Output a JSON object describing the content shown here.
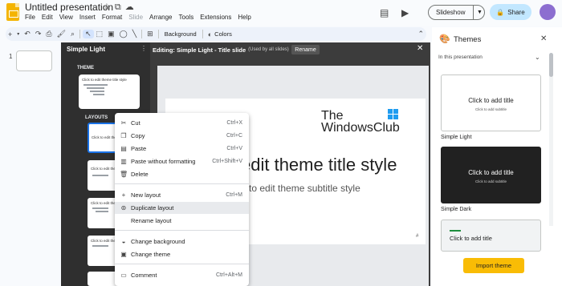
{
  "header": {
    "doc_title": "Untitled presentation",
    "title_icons": [
      "star-icon",
      "move-folder-icon",
      "cloud-status-icon"
    ],
    "menu": [
      "File",
      "Edit",
      "View",
      "Insert",
      "Format",
      "Slide",
      "Arrange",
      "Tools",
      "Extensions",
      "Help"
    ],
    "slideshow_label": "Slideshow",
    "share_label": "Share",
    "brand_color": "#f4b400",
    "share_color": "#c2e7ff"
  },
  "toolbar": {
    "background_label": "Background",
    "colors_label": "Colors"
  },
  "filmstrip": {
    "slide_number": "1"
  },
  "theme_builder": {
    "title": "Simple Light",
    "theme_section": "THEME",
    "layouts_section": "LAYOUTS",
    "editing_title": "Editing: Simple Light - Title slide",
    "editing_sub": "(Used by all slides)",
    "rename_label": "Rename",
    "theme_thumb_text": "Click to edit theme title style",
    "layout_thumb_text": "Click to edit theme title",
    "layout_thumb_text2": "Click to edit theme title style"
  },
  "slide": {
    "logo_line1": "The",
    "logo_line2": "WindowsClub",
    "title": "edit theme title style",
    "subtitle": "to edit theme subtitle style",
    "page_mark": "#"
  },
  "context_menu": {
    "items": [
      {
        "label": "Cut",
        "shortcut": "Ctrl+X",
        "icon": "cut-icon"
      },
      {
        "label": "Copy",
        "shortcut": "Ctrl+C",
        "icon": "copy-icon"
      },
      {
        "label": "Paste",
        "shortcut": "Ctrl+V",
        "icon": "paste-icon"
      },
      {
        "label": "Paste without formatting",
        "shortcut": "Ctrl+Shift+V",
        "icon": "paste-plain-icon"
      },
      {
        "label": "Delete",
        "shortcut": "",
        "icon": "delete-icon"
      },
      {
        "label": "New layout",
        "shortcut": "Ctrl+M",
        "icon": "plus-icon"
      },
      {
        "label": "Duplicate layout",
        "shortcut": "",
        "icon": "duplicate-icon"
      },
      {
        "label": "Rename layout",
        "shortcut": "",
        "icon": ""
      },
      {
        "label": "Change background",
        "shortcut": "",
        "icon": "background-icon"
      },
      {
        "label": "Change theme",
        "shortcut": "",
        "icon": "theme-icon"
      },
      {
        "label": "Comment",
        "shortcut": "Ctrl+Alt+M",
        "icon": "comment-icon"
      }
    ]
  },
  "themes": {
    "title": "Themes",
    "filter": "In this presentation",
    "cards": [
      {
        "name": "Simple Light",
        "title": "Click to add title",
        "subtitle": "Click to add subtitle"
      },
      {
        "name": "Simple Dark",
        "title": "Click to add title",
        "subtitle": "Click to add subtitle"
      },
      {
        "name": "",
        "title": "Click to add title",
        "subtitle": ""
      }
    ],
    "import_label": "Import theme",
    "import_color": "#f9bc05"
  }
}
